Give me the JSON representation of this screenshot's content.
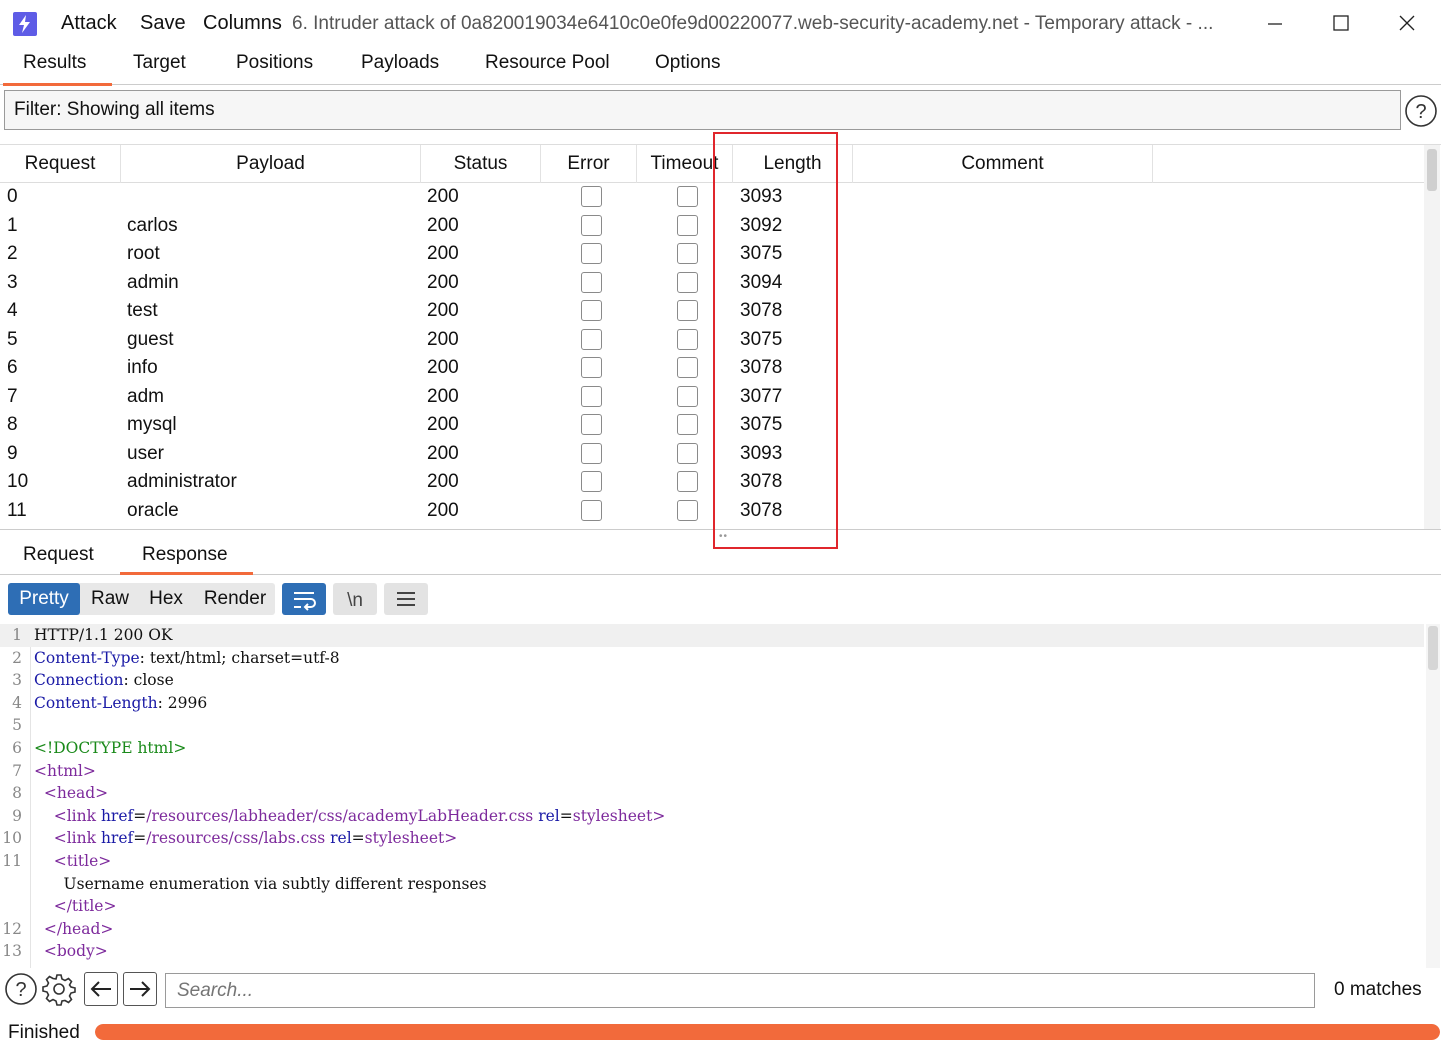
{
  "titlebar": {
    "menu": [
      "Attack",
      "Save",
      "Columns"
    ],
    "title": "6. Intruder attack of 0a820019034e6410c0e0fe9d00220077.web-security-academy.net - Temporary attack - ..."
  },
  "tabs": [
    "Results",
    "Target",
    "Positions",
    "Payloads",
    "Resource Pool",
    "Options"
  ],
  "active_tab": "Results",
  "filter": {
    "label": "Filter: Showing all items"
  },
  "table": {
    "columns": [
      "Request",
      "Payload",
      "Status",
      "Error",
      "Timeout",
      "Length",
      "Comment"
    ],
    "rows": [
      {
        "request": "0",
        "payload": "",
        "status": "200",
        "error": false,
        "timeout": false,
        "length": "3093",
        "comment": ""
      },
      {
        "request": "1",
        "payload": "carlos",
        "status": "200",
        "error": false,
        "timeout": false,
        "length": "3092",
        "comment": ""
      },
      {
        "request": "2",
        "payload": "root",
        "status": "200",
        "error": false,
        "timeout": false,
        "length": "3075",
        "comment": ""
      },
      {
        "request": "3",
        "payload": "admin",
        "status": "200",
        "error": false,
        "timeout": false,
        "length": "3094",
        "comment": ""
      },
      {
        "request": "4",
        "payload": "test",
        "status": "200",
        "error": false,
        "timeout": false,
        "length": "3078",
        "comment": ""
      },
      {
        "request": "5",
        "payload": "guest",
        "status": "200",
        "error": false,
        "timeout": false,
        "length": "3075",
        "comment": ""
      },
      {
        "request": "6",
        "payload": "info",
        "status": "200",
        "error": false,
        "timeout": false,
        "length": "3078",
        "comment": ""
      },
      {
        "request": "7",
        "payload": "adm",
        "status": "200",
        "error": false,
        "timeout": false,
        "length": "3077",
        "comment": ""
      },
      {
        "request": "8",
        "payload": "mysql",
        "status": "200",
        "error": false,
        "timeout": false,
        "length": "3075",
        "comment": ""
      },
      {
        "request": "9",
        "payload": "user",
        "status": "200",
        "error": false,
        "timeout": false,
        "length": "3093",
        "comment": ""
      },
      {
        "request": "10",
        "payload": "administrator",
        "status": "200",
        "error": false,
        "timeout": false,
        "length": "3078",
        "comment": ""
      },
      {
        "request": "11",
        "payload": "oracle",
        "status": "200",
        "error": false,
        "timeout": false,
        "length": "3078",
        "comment": ""
      }
    ]
  },
  "message_tabs": [
    "Request",
    "Response"
  ],
  "active_message_tab": "Response",
  "view_modes": [
    "Pretty",
    "Raw",
    "Hex",
    "Render"
  ],
  "active_view_mode": "Pretty",
  "view_icons": [
    "wrap-lines-icon",
    "newline-icon",
    "menu-icon"
  ],
  "code_lines": [
    {
      "n": "1",
      "text": "HTTP/1.1 200 OK"
    },
    {
      "n": "2",
      "text": "Content-Type: text/html; charset=utf-8"
    },
    {
      "n": "3",
      "text": "Connection: close"
    },
    {
      "n": "4",
      "text": "Content-Length: 2996"
    },
    {
      "n": "5",
      "text": ""
    },
    {
      "n": "6",
      "text": "<!DOCTYPE html>"
    },
    {
      "n": "7",
      "text": "<html>"
    },
    {
      "n": "8",
      "text": "  <head>"
    },
    {
      "n": "9",
      "text": "    <link href=/resources/labheader/css/academyLabHeader.css rel=stylesheet>"
    },
    {
      "n": "10",
      "text": "    <link href=/resources/css/labs.css rel=stylesheet>"
    },
    {
      "n": "11",
      "text": "    <title>"
    },
    {
      "n": "",
      "text": "      Username enumeration via subtly different responses"
    },
    {
      "n": "",
      "text": "    </title>"
    },
    {
      "n": "12",
      "text": "  </head>"
    },
    {
      "n": "13",
      "text": "  <body>"
    }
  ],
  "search": {
    "placeholder": "Search...",
    "matches": "0 matches"
  },
  "status": {
    "text": "Finished",
    "progress": 1.0
  },
  "colors": {
    "accent": "#f26a3b",
    "active_blue": "#2e6eb5",
    "highlight": "#e0262c"
  }
}
